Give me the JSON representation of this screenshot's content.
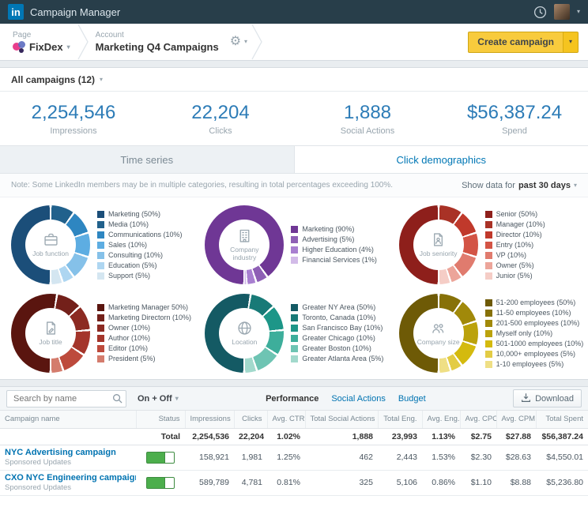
{
  "topbar": {
    "logo_text": "in",
    "app_title": "Campaign Manager"
  },
  "breadcrumb": {
    "page_label": "Page",
    "page_value": "FixDex",
    "account_label": "Account",
    "account_value": "Marketing Q4 Campaigns",
    "create_campaign_label": "Create campaign"
  },
  "campaign_filter": {
    "label": "All campaigns (12)"
  },
  "summary_stats": [
    {
      "value": "2,254,546",
      "label": "Impressions"
    },
    {
      "value": "22,204",
      "label": "Clicks"
    },
    {
      "value": "1,888",
      "label": "Social Actions"
    },
    {
      "value": "$56,387.24",
      "label": "Spend"
    }
  ],
  "view_tabs": [
    {
      "label": "Time series",
      "active": false
    },
    {
      "label": "Click demographics",
      "active": true
    }
  ],
  "note": "Note: Some LinkedIn members may be in multiple categories, resulting in total percentages exceeding 100%.",
  "show_data": {
    "prefix": "Show data for",
    "range": "past 30 days"
  },
  "palette": {
    "accent_blue": "#0077b5",
    "stat_blue": "#2d7cb7",
    "create_yellow": "#f8cb3d",
    "toggle_green": "#4cae4c",
    "topbar_bg": "#283e4a"
  },
  "chart_data": [
    {
      "type": "pie",
      "title": "Job function",
      "center_icon": "briefcase-icon",
      "segments": [
        {
          "label": "Marketing (50%)",
          "value": 50,
          "color": "#1b4e79"
        },
        {
          "label": "Media (10%)",
          "value": 10,
          "color": "#21618c"
        },
        {
          "label": "Communications (10%)",
          "value": 10,
          "color": "#2e86c1"
        },
        {
          "label": "Sales (10%)",
          "value": 10,
          "color": "#5dade2"
        },
        {
          "label": "Consulting (10%)",
          "value": 10,
          "color": "#85c1e9"
        },
        {
          "label": "Education (5%)",
          "value": 5,
          "color": "#aed6f1"
        },
        {
          "label": "Support (5%)",
          "value": 5,
          "color": "#d4e6f1"
        }
      ]
    },
    {
      "type": "pie",
      "title": "Company industry",
      "center_icon": "building-icon",
      "segments": [
        {
          "label": "Marketing (90%)",
          "value": 90,
          "color": "#6f3795"
        },
        {
          "label": "Advertising (5%)",
          "value": 5,
          "color": "#8e5fb5"
        },
        {
          "label": "Higher Education (4%)",
          "value": 4,
          "color": "#a87fd0"
        },
        {
          "label": "Financial Services (1%)",
          "value": 1,
          "color": "#d2bbe8"
        }
      ]
    },
    {
      "type": "pie",
      "title": "Job seniority",
      "center_icon": "document-person-icon",
      "segments": [
        {
          "label": "Senior (50%)",
          "value": 50,
          "color": "#8e1f1b"
        },
        {
          "label": "Manager (10%)",
          "value": 10,
          "color": "#a93226"
        },
        {
          "label": "Director (10%)",
          "value": 10,
          "color": "#c0392b"
        },
        {
          "label": "Entry (10%)",
          "value": 10,
          "color": "#d35445"
        },
        {
          "label": "VP (10%)",
          "value": 10,
          "color": "#e07b6e"
        },
        {
          "label": "Owner (5%)",
          "value": 5,
          "color": "#eca59a"
        },
        {
          "label": "Junior (5%)",
          "value": 5,
          "color": "#f5cdc6"
        }
      ]
    },
    {
      "type": "pie",
      "title": "Job title",
      "center_icon": "document-pencil-icon",
      "segments": [
        {
          "label": "Marketing Manager 50%)",
          "value": 50,
          "color": "#5a150f"
        },
        {
          "label": "Marketing Directorn (10%)",
          "value": 10,
          "color": "#73201a"
        },
        {
          "label": "Owner (10%)",
          "value": 10,
          "color": "#8c2a22"
        },
        {
          "label": "Author (10%)",
          "value": 10,
          "color": "#a4352b"
        },
        {
          "label": "Editor (10%)",
          "value": 10,
          "color": "#bd4a3c"
        },
        {
          "label": "President (5%)",
          "value": 5,
          "color": "#d47c6d"
        }
      ]
    },
    {
      "type": "pie",
      "title": "Location",
      "center_icon": "globe-icon",
      "segments": [
        {
          "label": "Greater NY Area (50%)",
          "value": 50,
          "color": "#145a64"
        },
        {
          "label": "Toronto, Canada (10%)",
          "value": 10,
          "color": "#187a77"
        },
        {
          "label": "San Francisco Bay (10%)",
          "value": 10,
          "color": "#1d9688"
        },
        {
          "label": "Greater Chicago (10%)",
          "value": 10,
          "color": "#3dae9b"
        },
        {
          "label": "Greater Boston (10%)",
          "value": 10,
          "color": "#6ec4b3"
        },
        {
          "label": "Greater Atlanta Area (5%)",
          "value": 5,
          "color": "#a2d9cc"
        }
      ]
    },
    {
      "type": "pie",
      "title": "Company size",
      "center_icon": "people-icon",
      "segments": [
        {
          "label": "51-200 employees (50%)",
          "value": 50,
          "color": "#6e5a06"
        },
        {
          "label": "11-50 employees (10%)",
          "value": 10,
          "color": "#877108"
        },
        {
          "label": "201-500 employees (10%)",
          "value": 10,
          "color": "#a1890a"
        },
        {
          "label": "Myself only (10%)",
          "value": 10,
          "color": "#bba20c"
        },
        {
          "label": "501-1000 employees (10%)",
          "value": 10,
          "color": "#d4ba0e"
        },
        {
          "label": "10,000+ employees (5%)",
          "value": 5,
          "color": "#e3cc45"
        },
        {
          "label": "1-10 employees (5%)",
          "value": 5,
          "color": "#efdf85"
        }
      ]
    }
  ],
  "table_section": {
    "search_placeholder": "Search by name",
    "status_filter": "On + Off",
    "tabs": [
      {
        "label": "Performance",
        "active": true
      },
      {
        "label": "Social Actions",
        "active": false
      },
      {
        "label": "Budget",
        "active": false
      }
    ],
    "download_label": "Download",
    "columns": [
      "Campaign name",
      "Status",
      "Impressions",
      "Clicks",
      "Avg. CTR",
      "Total Social Actions",
      "Total Eng.",
      "Avg. Eng.",
      "Avg. CPC",
      "Avg. CPM",
      "Total Spent"
    ],
    "total_row": {
      "label": "Total",
      "values": [
        "2,254,536",
        "22,204",
        "1.02%",
        "1,888",
        "23,993",
        "1.13%",
        "$2.75",
        "$27.88",
        "$56,387.24"
      ]
    },
    "rows": [
      {
        "name": "NYC Advertising campaign",
        "subtitle": "Sponsored Updates",
        "status_on": true,
        "values": [
          "158,921",
          "1,981",
          "1.25%",
          "462",
          "2,443",
          "1.53%",
          "$2.30",
          "$28.63",
          "$4,550.01"
        ]
      },
      {
        "name": "CXO NYC Engineering campaign",
        "subtitle": "Sponsored Updates",
        "status_on": true,
        "values": [
          "589,789",
          "4,781",
          "0.81%",
          "325",
          "5,106",
          "0.86%",
          "$1.10",
          "$8.88",
          "$5,236.80"
        ]
      }
    ]
  }
}
